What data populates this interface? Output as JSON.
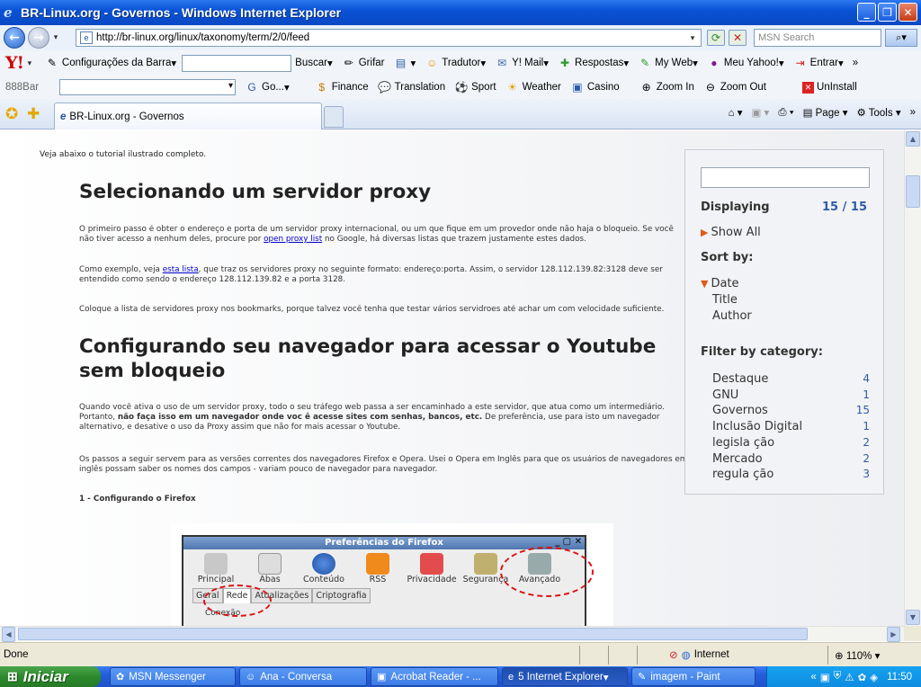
{
  "window": {
    "title": "BR-Linux.org - Governos - Windows Internet Explorer"
  },
  "address": {
    "url": "http://br-linux.org/linux/taxonomy/term/2/0/feed",
    "search_placeholder": "MSN Search"
  },
  "yahoo_toolbar": {
    "config": "Configurações da Barra",
    "search_btn": "Buscar",
    "grifar": "Grifar",
    "items": [
      "Tradutor",
      "Y! Mail",
      "Respostas",
      "My Web",
      "Meu Yahoo!",
      "Entrar"
    ]
  },
  "bar888": {
    "label": "888Bar",
    "go": "Go...",
    "items": [
      "Finance",
      "Translation",
      "Sport",
      "Weather",
      "Casino",
      "Zoom In",
      "Zoom Out",
      "UnInstall"
    ]
  },
  "tab": {
    "label": "BR-Linux.org - Governos"
  },
  "commands": {
    "page": "Page",
    "tools": "Tools"
  },
  "article": {
    "intro": "Veja abaixo o tutorial ilustrado completo.",
    "h1": "Selecionando um servidor proxy",
    "p1a": "O primeiro passo é obter o endereço e porta de um servidor proxy internacional, ou um que fique em um provedor onde não haja o bloqueio. Se você não tiver acesso a nenhum deles, procure por ",
    "p1link": "open proxy list",
    "p1b": " no Google, há diversas listas que trazem justamente estes dados.",
    "p2a": "Como exemplo, veja ",
    "p2link": "esta lista",
    "p2b": ", que traz os servidores proxy no seguinte formato: endereço:porta. Assim, o servidor 128.112.139.82:3128 deve ser entendido como sendo o endereço 128.112.139.82 e a porta 3128.",
    "p3": "Coloque a lista de servidores proxy nos bookmarks, porque talvez você tenha que testar vários servidroes até achar um com velocidade suficiente.",
    "h2": "Configurando seu navegador para acessar o Youtube sem bloqueio",
    "p4a": "Quando você ativa o uso de um servidor proxy, todo o seu tráfego web passa a ser encaminhado a este servidor, que atua como um intermediário. Portanto, ",
    "p4bold": "não faça isso em um navegador onde voc  ê acesse sites com senhas, bancos, etc.",
    "p4b": " De preferência, use para isto um navegador alternativo, e desative o uso da Proxy assim que não for mais acessar o Youtube.",
    "p5": "Os passos a seguir servem para as versões correntes dos navegadores Firefox e Opera. Usei o Opera em Inglês para que os usuários de navegadores em inglês possam saber os nomes dos campos - variam pouco de navegador para navegador.",
    "h3": "1 - Configurando o Firefox"
  },
  "screenshot_dialog": {
    "title": "Preferências do Firefox",
    "icons": [
      "Principal",
      "Abas",
      "Conteúdo",
      "RSS",
      "Privacidade",
      "Segurança",
      "Avançado"
    ],
    "subtabs": [
      "Geral",
      "Rede",
      "Atualizações",
      "Criptografia"
    ],
    "section": "Conexão"
  },
  "sidebar": {
    "displaying_label": "Displaying",
    "displaying_value": "15 / 15",
    "show_all": "Show All",
    "sort_by": "Sort by:",
    "sort_options": [
      "Date",
      "Title",
      "Author"
    ],
    "filter_label": "Filter by category:",
    "categories": [
      {
        "name": "Destaque",
        "count": "4"
      },
      {
        "name": "GNU",
        "count": "1"
      },
      {
        "name": "Governos",
        "count": "15"
      },
      {
        "name": "Inclusão Digital",
        "count": "1"
      },
      {
        "name": "legisla ção",
        "count": "2"
      },
      {
        "name": "Mercado",
        "count": "2"
      },
      {
        "name": "regula ção",
        "count": "3"
      }
    ]
  },
  "status": {
    "done": "Done",
    "zone": "Internet",
    "zoom": "110%"
  },
  "taskbar": {
    "start": "Iniciar",
    "tasks": [
      "MSN Messenger",
      "Ana - Conversa",
      "Acrobat Reader - ...",
      "5 Internet Explorer",
      "imagem - Paint"
    ],
    "clock": "11:50"
  }
}
